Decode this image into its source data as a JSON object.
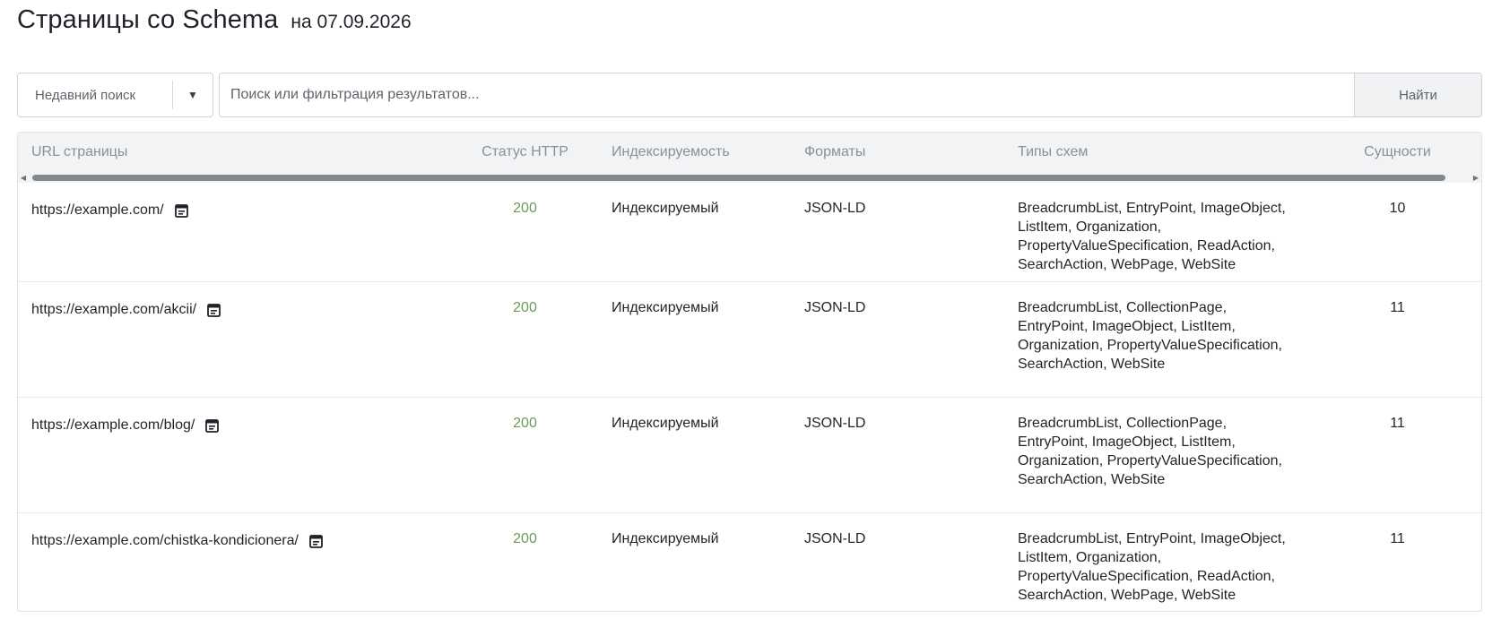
{
  "header": {
    "title": "Страницы со Schema",
    "date": "на 07.09.2026"
  },
  "toolbar": {
    "recent_label": "Недавний поиск",
    "search_placeholder": "Поиск или фильтрация результатов...",
    "search_value": "",
    "search_button": "Найти"
  },
  "table": {
    "columns": {
      "url": "URL страницы",
      "status": "Статус HTTP",
      "index": "Индексируемость",
      "formats": "Форматы",
      "types": "Типы схем",
      "entities": "Сущности"
    },
    "rows": [
      {
        "url": "https://example.com/",
        "status": "200",
        "index": "Индексируемый",
        "formats": "JSON-LD",
        "types": "BreadcrumbList, EntryPoint, ImageObject, ListItem, Organization, PropertyValueSpecification, ReadAction, SearchAction, WebPage, WebSite",
        "entities": "10"
      },
      {
        "url": "https://example.com/akcii/",
        "status": "200",
        "index": "Индексируемый",
        "formats": "JSON-LD",
        "types": "BreadcrumbList, CollectionPage, EntryPoint, ImageObject, ListItem, Organization, PropertyValueSpecification, SearchAction, WebSite",
        "entities": "11"
      },
      {
        "url": "https://example.com/blog/",
        "status": "200",
        "index": "Индексируемый",
        "formats": "JSON-LD",
        "types": "BreadcrumbList, CollectionPage, EntryPoint, ImageObject, ListItem, Organization, PropertyValueSpecification, SearchAction, WebSite",
        "entities": "11"
      },
      {
        "url": "https://example.com/chistka-kondicionera/",
        "status": "200",
        "index": "Индексируемый",
        "formats": "JSON-LD",
        "types": "BreadcrumbList, EntryPoint, ImageObject, ListItem, Organization, PropertyValueSpecification, ReadAction, SearchAction, WebPage, WebSite",
        "entities": "11"
      }
    ]
  },
  "scrollbar": {
    "visible_fraction": 0.985
  },
  "icons": {
    "row_action": "calendar-icon",
    "dropdown": "triangle-down-icon",
    "scroll_left": "triangle-left-icon",
    "scroll_right": "triangle-right-icon"
  },
  "colors": {
    "status_ok": "#6e9a57",
    "header_bg": "#f2f3f5",
    "scroll_thumb": "#858a90"
  }
}
